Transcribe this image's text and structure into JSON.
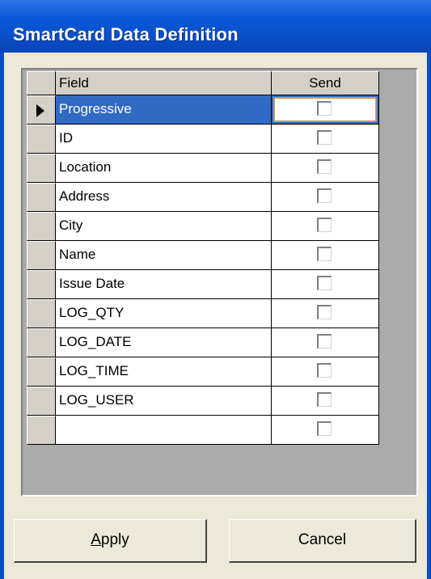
{
  "window": {
    "title": "SmartCard Data Definition"
  },
  "grid": {
    "headers": {
      "field": "Field",
      "send": "Send"
    },
    "rows": [
      {
        "field": "Progressive",
        "send": false,
        "current": true
      },
      {
        "field": "ID",
        "send": false
      },
      {
        "field": "Location",
        "send": false
      },
      {
        "field": "Address",
        "send": false
      },
      {
        "field": "City",
        "send": false
      },
      {
        "field": "Name",
        "send": false
      },
      {
        "field": "Issue Date",
        "send": false
      },
      {
        "field": "LOG_QTY",
        "send": false
      },
      {
        "field": "LOG_DATE",
        "send": false
      },
      {
        "field": "LOG_TIME",
        "send": false
      },
      {
        "field": "LOG_USER",
        "send": false
      },
      {
        "field": "",
        "send": false
      }
    ]
  },
  "buttons": {
    "apply_accel": "A",
    "apply_rest": "pply",
    "cancel": "Cancel"
  },
  "colors": {
    "selection": "#316AC5",
    "titlebar": "#0A4FC9",
    "dialog_bg": "#ECE9D8"
  }
}
